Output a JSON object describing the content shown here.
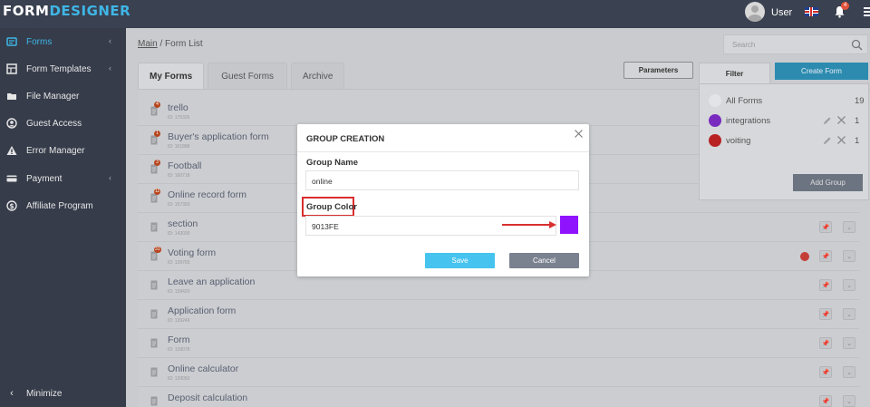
{
  "header": {
    "logo_part1": "FORM",
    "logo_part2": "DESIGNER",
    "user_name": "User",
    "notification_count": "4"
  },
  "sidebar": {
    "items": [
      {
        "label": "Forms",
        "icon": "forms-icon",
        "active": true,
        "has_chevron": true
      },
      {
        "label": "Form Templates",
        "icon": "templates-icon",
        "has_chevron": true
      },
      {
        "label": "File Manager",
        "icon": "folder-icon"
      },
      {
        "label": "Guest Access",
        "icon": "user-circle-icon"
      },
      {
        "label": "Error Manager",
        "icon": "warning-icon"
      },
      {
        "label": "Payment",
        "icon": "card-icon",
        "has_chevron": true
      },
      {
        "label": "Affiliate Program",
        "icon": "dollar-icon"
      }
    ],
    "minimize_label": "Minimize"
  },
  "breadcrumb": {
    "main": "Main",
    "separator": " / ",
    "current": "Form List"
  },
  "search": {
    "placeholder": "Search"
  },
  "tabs": [
    "My Forms",
    "Guest Forms",
    "Archive"
  ],
  "parameters_label": "Parameters",
  "filter_label": "Filter",
  "create_form_label": "Create Form",
  "groups": [
    {
      "name": "All Forms",
      "count": "19",
      "color": "#e2e4e7"
    },
    {
      "name": "integrations",
      "count": "1",
      "color": "#8a22e8"
    },
    {
      "name": "voiting",
      "count": "1",
      "color": "#d92222"
    }
  ],
  "add_group_label": "Add Group",
  "forms": [
    {
      "name": "trello",
      "id": "ID: 175326",
      "badge": "4"
    },
    {
      "name": "Buyer's application form",
      "id": "ID: 161888",
      "badge": "1"
    },
    {
      "name": "Football",
      "id": "ID: 160718",
      "badge": "3"
    },
    {
      "name": "Online record form",
      "id": "ID: 157393",
      "badge": "11"
    },
    {
      "name": "section",
      "id": "ID: 143039",
      "badge": ""
    },
    {
      "name": "Voting form",
      "id": "ID: 139765",
      "badge": "31"
    },
    {
      "name": "Leave an application",
      "id": "ID: 139420",
      "badge": ""
    },
    {
      "name": "Application form",
      "id": "ID: 139249",
      "badge": ""
    },
    {
      "name": "Form",
      "id": "ID: 139078",
      "badge": ""
    },
    {
      "name": "Online calculator",
      "id": "ID: 139050",
      "badge": ""
    },
    {
      "name": "Deposit calculation",
      "id": "",
      "badge": ""
    }
  ],
  "dialog": {
    "title": "GROUP CREATION",
    "group_name_label": "Group Name",
    "group_name_value": "online",
    "group_color_label": "Group Color",
    "group_color_value": "9013FE",
    "swatch_color": "#9013FE",
    "save_label": "Save",
    "cancel_label": "Cancel"
  }
}
